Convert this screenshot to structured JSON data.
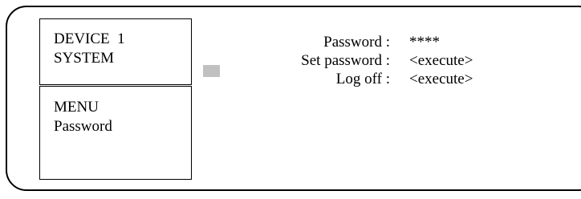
{
  "device_panel": {
    "line1": "DEVICE  1",
    "line2": "SYSTEM"
  },
  "menu_panel": {
    "line1": "MENU",
    "line2": "Password"
  },
  "menu_items": [
    {
      "label": "Password :",
      "value": "****"
    },
    {
      "label": "Set password :",
      "value": "<execute>"
    },
    {
      "label": "Log off :",
      "value": "<execute>"
    }
  ],
  "colors": {
    "indicator": "#c0c0c0",
    "frame": "#000000"
  }
}
